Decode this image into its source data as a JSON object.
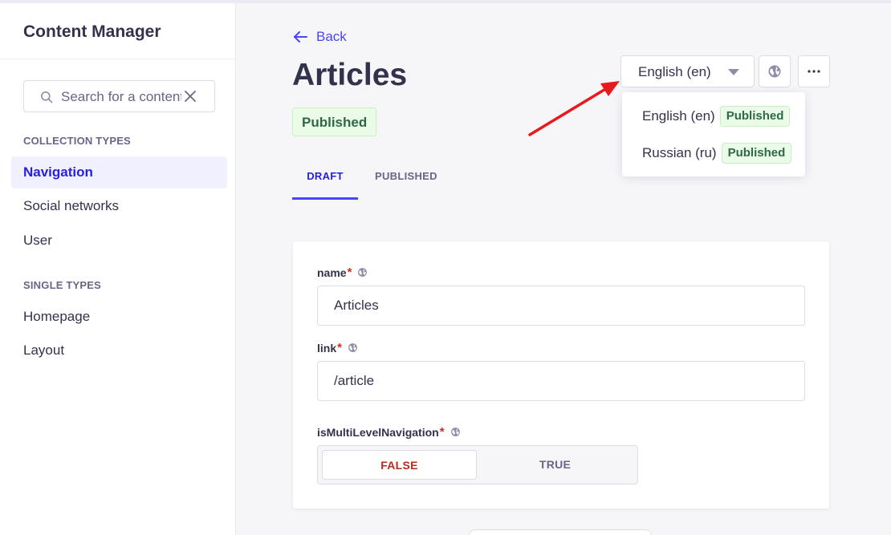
{
  "sidebar": {
    "title": "Content Manager",
    "search": {
      "placeholder": "Search for a content type",
      "value": ""
    },
    "sections": [
      {
        "label": "COLLECTION TYPES",
        "items": [
          {
            "label": "Navigation",
            "active": true
          },
          {
            "label": "Social networks"
          },
          {
            "label": "User"
          }
        ]
      },
      {
        "label": "SINGLE TYPES",
        "items": [
          {
            "label": "Homepage"
          },
          {
            "label": "Layout"
          }
        ]
      }
    ]
  },
  "header": {
    "back_label": "Back",
    "title": "Articles",
    "status": "Published",
    "tabs": [
      {
        "label": "DRAFT",
        "active": true
      },
      {
        "label": "PUBLISHED"
      }
    ]
  },
  "locale": {
    "selected": "English (en)",
    "options": [
      {
        "label": "English (en)",
        "status": "Published"
      },
      {
        "label": "Russian (ru)",
        "status": "Published"
      }
    ]
  },
  "form": {
    "fields": [
      {
        "label": "name",
        "value": "Articles"
      },
      {
        "label": "link",
        "value": "/article"
      },
      {
        "label": "isMultiLevelNavigation",
        "options": [
          "FALSE",
          "TRUE"
        ],
        "selected": "FALSE"
      }
    ],
    "required_mark": "*"
  },
  "colors": {
    "accent": "#4945ff",
    "success_bg": "#eafbe7",
    "success_text": "#2f6846",
    "danger": "#d02b20",
    "annotation_arrow": "#e8191b"
  },
  "icons": {
    "back": "arrow-left-icon",
    "search": "search-icon",
    "clear": "close-icon",
    "globe": "globe-icon",
    "more": "more-horizontal-icon",
    "caret": "caret-down-icon"
  }
}
